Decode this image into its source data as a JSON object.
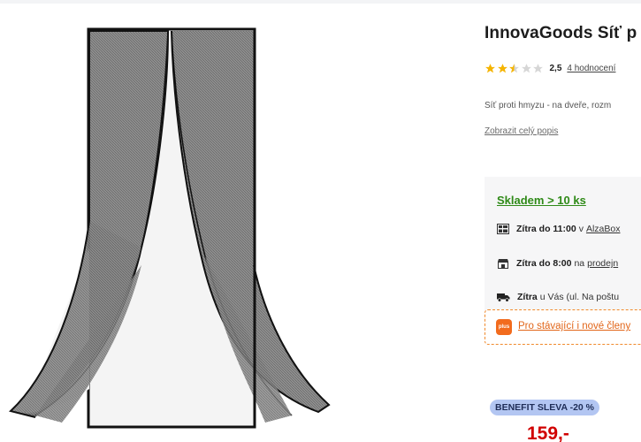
{
  "product": {
    "title": "InnovaGoods Síť p",
    "rating_value": "2,5",
    "rating_stars": 2.5,
    "rating_count": "4 hodnocení",
    "short_description": "Síť proti hmyzu - na dveře, rozm",
    "show_full_description": "Zobrazit celý popis",
    "image_icon": "magnetic-door-screen-image"
  },
  "availability": {
    "stock_label": "Skladem > 10 ks",
    "options": [
      {
        "bold": "Zítra do 11:00",
        "text": " v ",
        "link": "AlzaBox"
      },
      {
        "bold": "Zítra do 8:00",
        "text": " na ",
        "link": "prodejn"
      },
      {
        "bold": "Zítra",
        "text": " u Vás (ul. Na poštu",
        "link": ""
      }
    ]
  },
  "alzaplus": {
    "logo_text": "plus",
    "text": "Pro stávající i nové členy"
  },
  "pricing": {
    "benefit_label": "BENEFIT SLEVA -20 %",
    "price": "159,-"
  },
  "colors": {
    "stock_green": "#2f8a18",
    "price_red": "#d10000",
    "alzaplus_orange": "#f26b1d",
    "benefit_blue": "#b3c6f2",
    "star_gold": "#f5b400"
  }
}
